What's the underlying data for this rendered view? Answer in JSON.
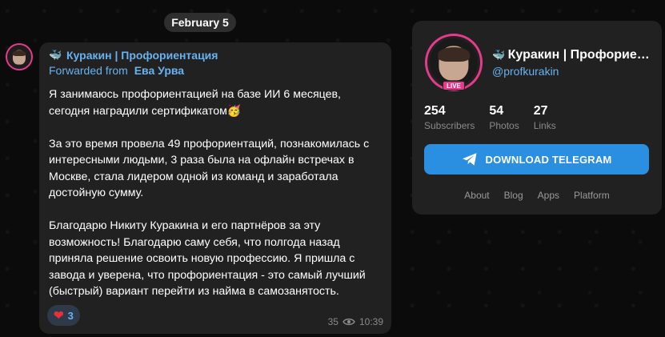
{
  "date_pill": "February 5",
  "message": {
    "channel_name": "Куракин | Профориентация",
    "forwarded_prefix": "Forwarded from",
    "forwarded_author": "Ева Урва",
    "text": "Я занимаюсь профориентацией на базе ИИ 6 месяцев, сегодня наградили сертификатом🥳\n\nЗа это время провела 49 профориентаций, познакомилась с интересными людьми, 3 раза была на офлайн встречах в Москве, стала лидером одной из команд и заработала достойную сумму.\n\nБлагодарю Никиту Куракина и его партнёров за эту возможность! Благодарю саму себя, что полгода назад приняла решение освоить новую профессию. Я пришла с завода и уверена, что профориентация - это самый лучший (быстрый) вариант перейти из найма в самозанятость.",
    "reaction_count": "3",
    "views": "35",
    "time": "10:39"
  },
  "card": {
    "title": "Куракин | Профориентация",
    "username": "@profkurakin",
    "live_label": "LIVE",
    "stats": [
      {
        "value": "254",
        "label": "Subscribers"
      },
      {
        "value": "54",
        "label": "Photos"
      },
      {
        "value": "27",
        "label": "Links"
      }
    ],
    "download_label": "DOWNLOAD TELEGRAM",
    "links": [
      "About",
      "Blog",
      "Apps",
      "Platform"
    ]
  },
  "colors": {
    "accent": "#68b2ef",
    "button": "#2a8fe0",
    "story_ring": "#e63b8b"
  },
  "icons": {
    "channel": "whale-emoji",
    "views": "eye-icon",
    "reaction": "heart-emoji",
    "download": "telegram-plane-icon"
  }
}
